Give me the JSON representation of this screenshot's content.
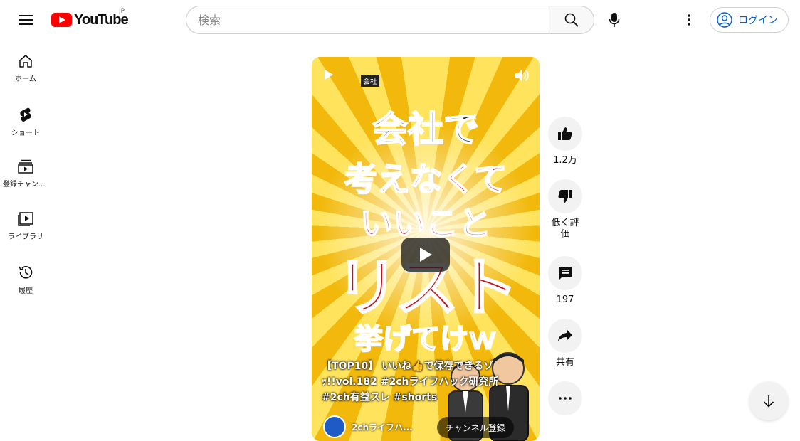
{
  "header": {
    "logo_text": "YouTube",
    "logo_region": "JP",
    "search_placeholder": "検索",
    "login_label": "ログイン"
  },
  "sidebar": {
    "items": [
      {
        "label": "ホーム",
        "icon": "home-icon"
      },
      {
        "label": "ショート",
        "icon": "shorts-icon"
      },
      {
        "label": "登録チャンネル",
        "icon": "subscriptions-icon"
      },
      {
        "label": "ライブラリ",
        "icon": "library-icon"
      },
      {
        "label": "履歴",
        "icon": "history-icon"
      }
    ]
  },
  "short": {
    "corner_tag": "会社",
    "thumb_lines": [
      "会社で",
      "考えなくて",
      "いいこと",
      "リスト",
      "挙げてけｗ"
    ],
    "caption": "【TOP10】 いいね👍で保存できるゾｯ!!vol.182 #2chライフハック研究所 #2ch有益スレ #shorts",
    "channel_name": "2chライフハ...",
    "subscribe_label": "チャンネル登録"
  },
  "actions": {
    "like_count": "1.2万",
    "dislike_label": "低く評価",
    "comment_count": "197",
    "share_label": "共有"
  },
  "colors": {
    "brand_red": "#ff0000",
    "link_blue": "#065fd4",
    "thumb_red": "#c4121a",
    "thumb_yellow": "#f5c518"
  }
}
